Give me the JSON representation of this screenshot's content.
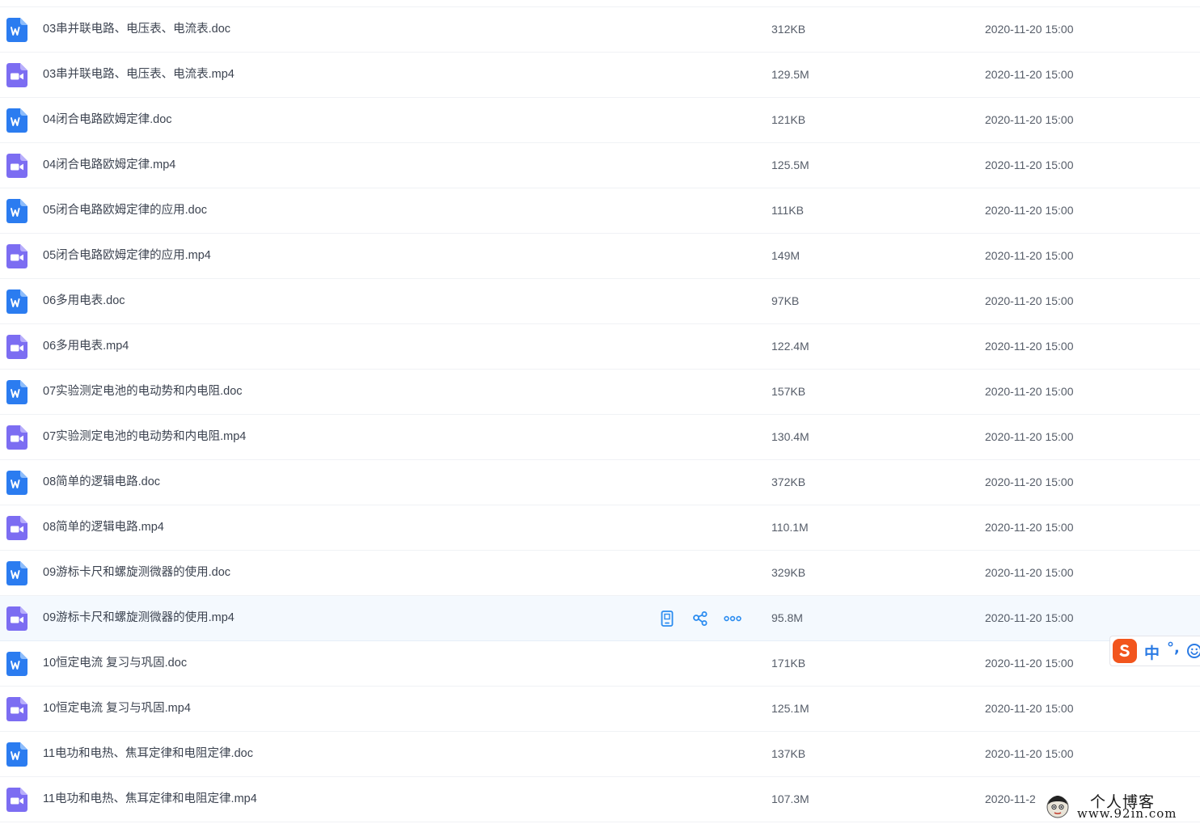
{
  "files": [
    {
      "name": "03串并联电路、电压表、电流表.doc",
      "size": "312KB",
      "date": "2020-11-20 15:00",
      "type": "doc"
    },
    {
      "name": "03串并联电路、电压表、电流表.mp4",
      "size": "129.5M",
      "date": "2020-11-20 15:00",
      "type": "video"
    },
    {
      "name": "04闭合电路欧姆定律.doc",
      "size": "121KB",
      "date": "2020-11-20 15:00",
      "type": "doc"
    },
    {
      "name": "04闭合电路欧姆定律.mp4",
      "size": "125.5M",
      "date": "2020-11-20 15:00",
      "type": "video"
    },
    {
      "name": "05闭合电路欧姆定律的应用.doc",
      "size": "111KB",
      "date": "2020-11-20 15:00",
      "type": "doc"
    },
    {
      "name": "05闭合电路欧姆定律的应用.mp4",
      "size": "149M",
      "date": "2020-11-20 15:00",
      "type": "video"
    },
    {
      "name": "06多用电表.doc",
      "size": "97KB",
      "date": "2020-11-20 15:00",
      "type": "doc"
    },
    {
      "name": "06多用电表.mp4",
      "size": "122.4M",
      "date": "2020-11-20 15:00",
      "type": "video"
    },
    {
      "name": "07实验测定电池的电动势和内电阻.doc",
      "size": "157KB",
      "date": "2020-11-20 15:00",
      "type": "doc"
    },
    {
      "name": "07实验测定电池的电动势和内电阻.mp4",
      "size": "130.4M",
      "date": "2020-11-20 15:00",
      "type": "video"
    },
    {
      "name": "08简单的逻辑电路.doc",
      "size": "372KB",
      "date": "2020-11-20 15:00",
      "type": "doc"
    },
    {
      "name": "08简单的逻辑电路.mp4",
      "size": "110.1M",
      "date": "2020-11-20 15:00",
      "type": "video"
    },
    {
      "name": "09游标卡尺和螺旋测微器的使用.doc",
      "size": "329KB",
      "date": "2020-11-20 15:00",
      "type": "doc"
    },
    {
      "name": "09游标卡尺和螺旋测微器的使用.mp4",
      "size": "95.8M",
      "date": "2020-11-20 15:00",
      "type": "video",
      "hovered": true
    },
    {
      "name": "10恒定电流 复习与巩固.doc",
      "size": "171KB",
      "date": "2020-11-20 15:00",
      "type": "doc"
    },
    {
      "name": "10恒定电流 复习与巩固.mp4",
      "size": "125.1M",
      "date": "2020-11-20 15:00",
      "type": "video"
    },
    {
      "name": "11电功和电热、焦耳定律和电阻定律.doc",
      "size": "137KB",
      "date": "2020-11-20 15:00",
      "type": "doc"
    },
    {
      "name": "11电功和电热、焦耳定律和电阻定律.mp4",
      "size": "107.3M",
      "date": "2020-11-2",
      "type": "video"
    }
  ],
  "row_actions": {
    "icons": [
      "phone-icon",
      "share-icon",
      "more-icon"
    ]
  },
  "icons": {
    "doc": "word-doc-icon",
    "video": "video-file-icon"
  },
  "colors": {
    "accent": "#2b8cf0",
    "doc_icon": "#2b7cf0",
    "video_icon": "#7c6df2",
    "hover_row": "#f4f9fe",
    "ime_brand": "#f2551d"
  },
  "ime": {
    "mode_label": "中",
    "punct_label": "°,"
  },
  "watermark": {
    "title": "个人博客",
    "url": "www.92in.com"
  }
}
